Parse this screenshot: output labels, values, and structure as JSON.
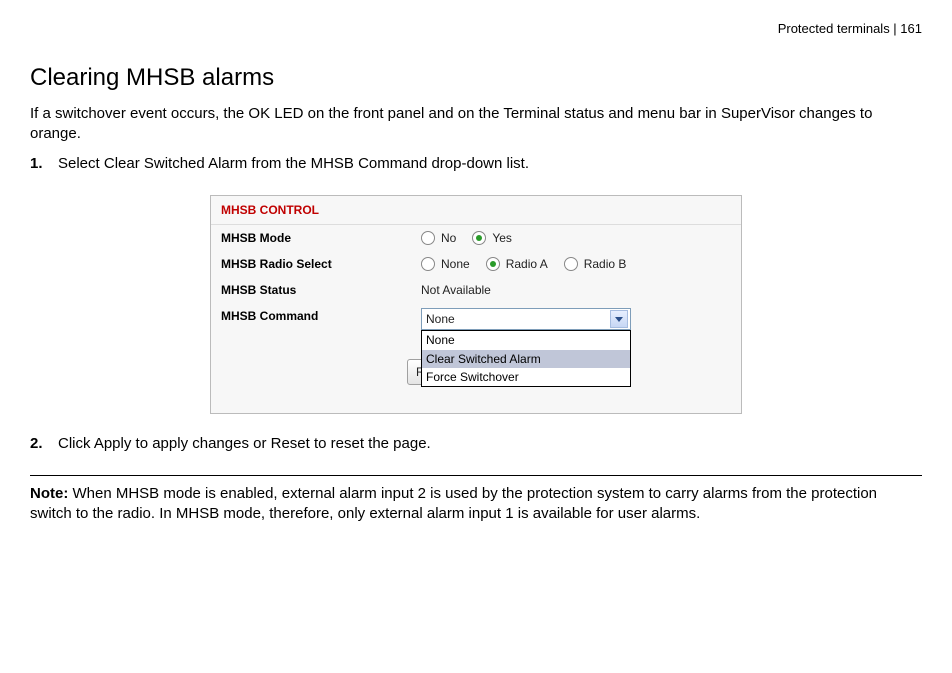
{
  "header": {
    "breadcrumb": "Protected terminals  |  161"
  },
  "title": "Clearing MHSB alarms",
  "intro": "If a switchover event occurs, the OK LED on the front panel and on the Terminal status and menu bar in SuperVisor changes to orange.",
  "steps": {
    "s1_num": "1.",
    "s1_text": "Select Clear Switched Alarm from the MHSB Command drop-down list.",
    "s2_num": "2.",
    "s2_text": "Click Apply to apply changes or Reset to reset the page."
  },
  "panel": {
    "title": "MHSB CONTROL",
    "mode_label": "MHSB Mode",
    "mode_no": "No",
    "mode_yes": "Yes",
    "radio_select_label": "MHSB Radio Select",
    "radio_none": "None",
    "radio_a": "Radio A",
    "radio_b": "Radio B",
    "status_label": "MHSB Status",
    "status_value": "Not Available",
    "command_label": "MHSB Command",
    "command_selected": "None",
    "command_options": {
      "o0": "None",
      "o1": "Clear Switched Alarm",
      "o2": "Force Switchover"
    },
    "reset_label": "Rese"
  },
  "note": {
    "prefix": "Note:",
    "body": " When MHSB mode is enabled, external alarm input 2 is used by the protection system to carry alarms from the protection switch to the radio. In MHSB mode, therefore, only external alarm input 1 is available for user alarms."
  }
}
